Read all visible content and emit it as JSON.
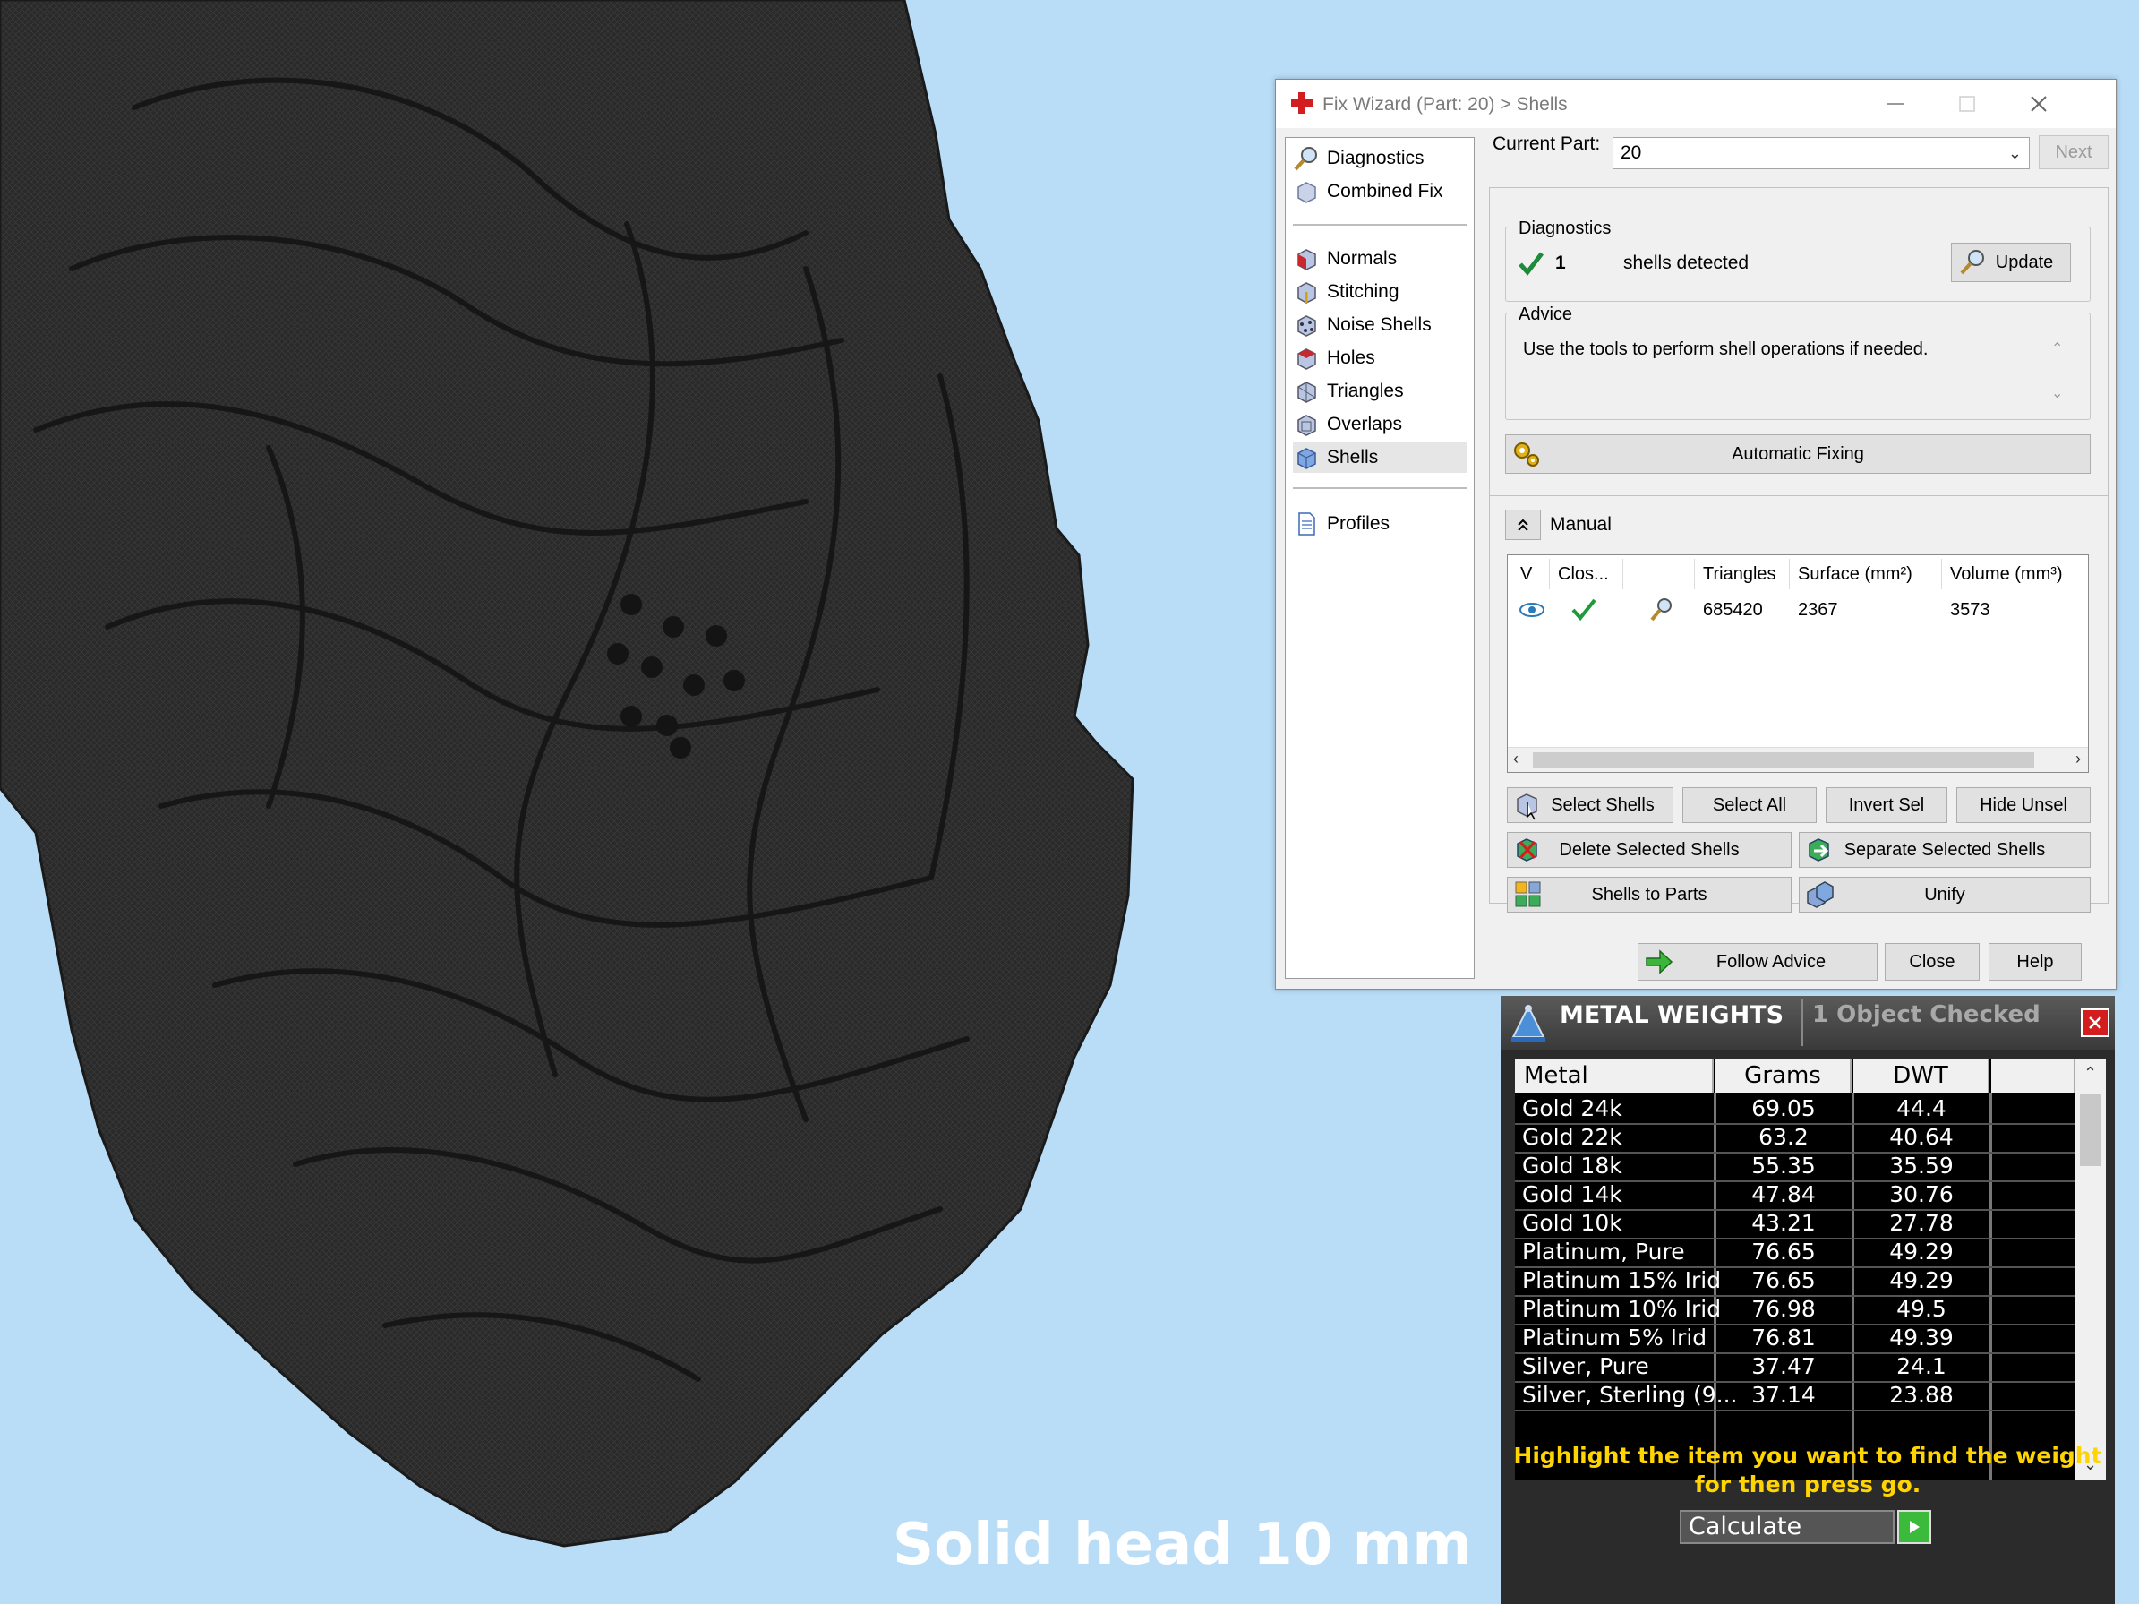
{
  "caption": "Solid head 10 mm",
  "fix_wizard": {
    "title": "Fix Wizard (Part: 20) > Shells",
    "nav": {
      "diagnostics": "Diagnostics",
      "combined_fix": "Combined Fix",
      "normals": "Normals",
      "stitching": "Stitching",
      "noise_shells": "Noise Shells",
      "holes": "Holes",
      "triangles": "Triangles",
      "overlaps": "Overlaps",
      "shells": "Shells",
      "profiles": "Profiles",
      "selected": "Shells"
    },
    "current_part_label": "Current Part:",
    "current_part_value": "20",
    "next_label": "Next",
    "diagnostics_group": "Diagnostics",
    "shells_count": "1",
    "shells_text": "shells detected",
    "update_label": "Update",
    "advice_group": "Advice",
    "advice_text": "Use the tools to perform shell operations if needed.",
    "automatic_fixing_label": "Automatic Fixing",
    "manual_label": "Manual",
    "table": {
      "headers": [
        "V",
        "Clos...",
        "",
        "Triangles",
        "Surface (mm²)",
        "Volume (mm³)"
      ],
      "row": {
        "triangles": "685420",
        "surface": "2367",
        "volume": "3573"
      }
    },
    "buttons": {
      "select_shells": "Select Shells",
      "select_all": "Select All",
      "invert_sel": "Invert Sel",
      "hide_unsel": "Hide Unsel",
      "delete_selected_shells": "Delete Selected Shells",
      "separate_selected_shells": "Separate Selected Shells",
      "shells_to_parts": "Shells to Parts",
      "unify": "Unify",
      "follow_advice": "Follow Advice",
      "close": "Close",
      "help": "Help"
    }
  },
  "metal_weights": {
    "title": "METAL WEIGHTS",
    "subtitle": "1 Object Checked",
    "headers": [
      "Metal",
      "Grams",
      "DWT"
    ],
    "rows": [
      {
        "metal": "Gold 24k",
        "grams": "69.05",
        "dwt": "44.4"
      },
      {
        "metal": "Gold 22k",
        "grams": "63.2",
        "dwt": "40.64"
      },
      {
        "metal": "Gold 18k",
        "grams": "55.35",
        "dwt": "35.59"
      },
      {
        "metal": "Gold 14k",
        "grams": "47.84",
        "dwt": "30.76"
      },
      {
        "metal": "Gold 10k",
        "grams": "43.21",
        "dwt": "27.78"
      },
      {
        "metal": "Platinum, Pure",
        "grams": "76.65",
        "dwt": "49.29"
      },
      {
        "metal": "Platinum 15% Irid",
        "grams": "76.65",
        "dwt": "49.29"
      },
      {
        "metal": "Platinum 10% Irid",
        "grams": "76.98",
        "dwt": "49.5"
      },
      {
        "metal": "Platinum 5% Irid",
        "grams": "76.81",
        "dwt": "49.39"
      },
      {
        "metal": "Silver, Pure",
        "grams": "37.47",
        "dwt": "24.1"
      },
      {
        "metal": "Silver, Sterling (9...",
        "grams": "37.14",
        "dwt": "23.88"
      }
    ],
    "hint": "Highlight the item you want to find the weight for then press go.",
    "calculate_label": "Calculate"
  }
}
